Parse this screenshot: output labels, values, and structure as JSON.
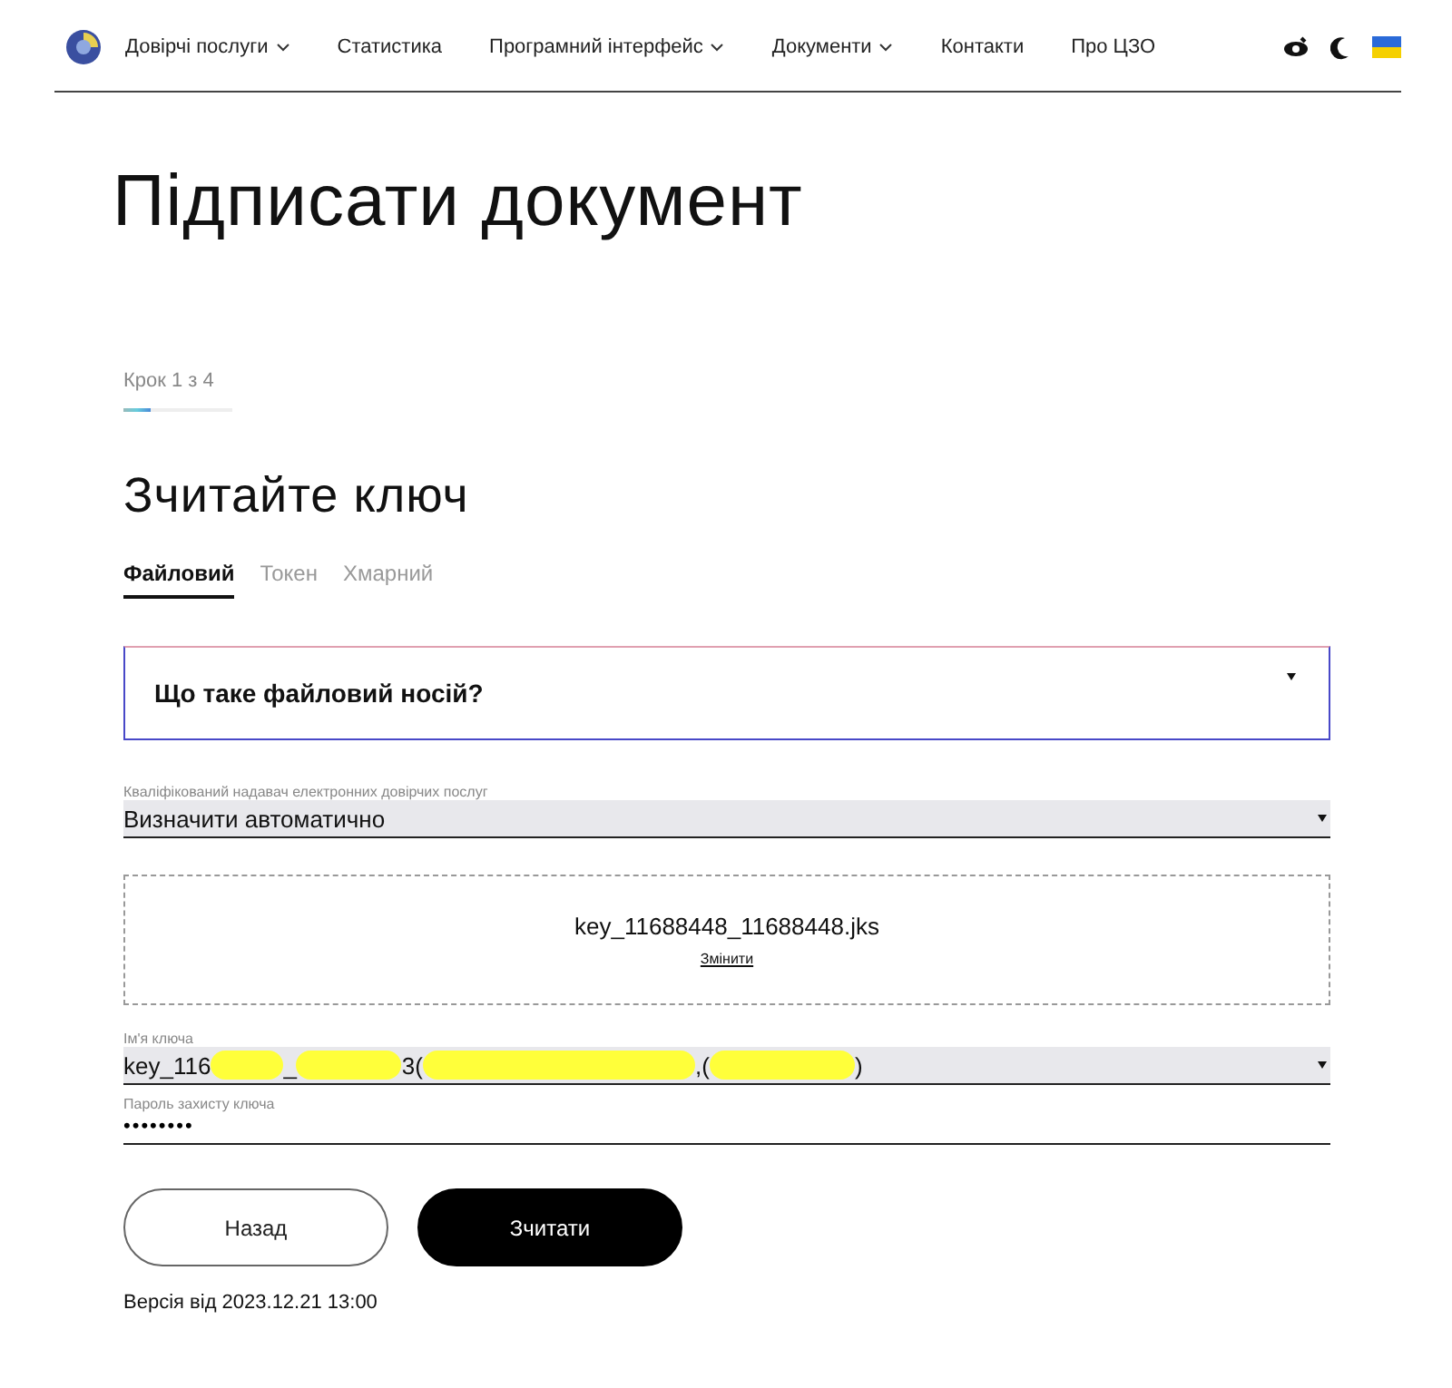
{
  "nav": {
    "items": [
      {
        "label": "Довірчі послуги",
        "dropdown": true
      },
      {
        "label": "Статистика",
        "dropdown": false
      },
      {
        "label": "Програмний інтерфейс",
        "dropdown": true
      },
      {
        "label": "Документи",
        "dropdown": true
      },
      {
        "label": "Контакти",
        "dropdown": false
      },
      {
        "label": "Про ЦЗО",
        "dropdown": false
      }
    ]
  },
  "page_title": "Підписати документ",
  "step": {
    "label": "Крок 1 з 4",
    "level": 0.25
  },
  "heading": "Зчитайте ключ",
  "tabs": [
    {
      "label": "Файловий",
      "selected": true
    },
    {
      "label": "Токен",
      "selected": false
    },
    {
      "label": "Хмарний",
      "selected": false
    }
  ],
  "accordion": {
    "title": "Що таке файловий носій?",
    "expanded": false
  },
  "provider": {
    "label": "Кваліфікований надавач електронних довірчих послуг",
    "value": "Визначити автоматично"
  },
  "file": {
    "name": "key_11688448_11688448.jks",
    "change_link": "Змінити"
  },
  "key_name": {
    "label": "Ім'я ключа",
    "value_parts": [
      "key_116",
      "_",
      "3(",
      ",(",
      ")"
    ]
  },
  "password": {
    "label": "Пароль захисту ключа",
    "value": "••••••••"
  },
  "buttons": [
    {
      "label": "Назад",
      "kind": "secondary"
    },
    {
      "label": "Зчитати",
      "kind": "primary"
    }
  ],
  "version": "Версія від 2023.12.21 13:00"
}
